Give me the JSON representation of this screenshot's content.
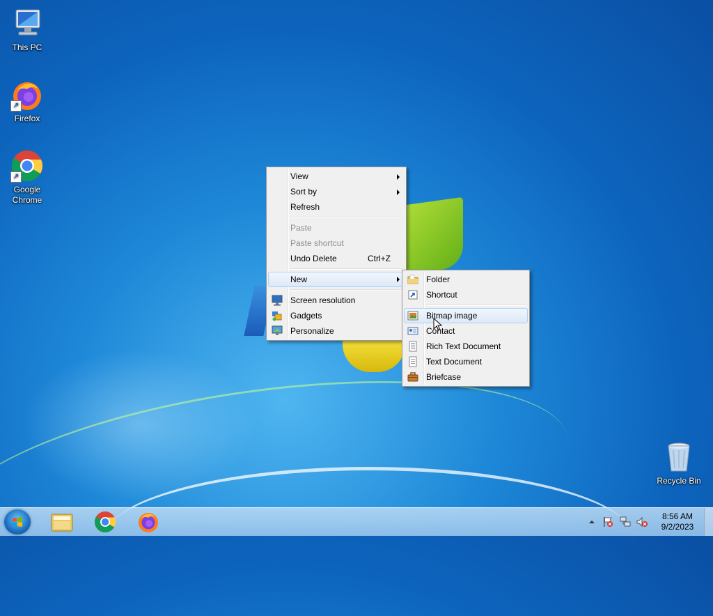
{
  "desktop": {
    "icons": [
      {
        "label": "This PC"
      },
      {
        "label": "Firefox"
      },
      {
        "label": "Google Chrome"
      },
      {
        "label": "Recycle Bin"
      }
    ]
  },
  "context_menu": {
    "view": "View",
    "sort_by": "Sort by",
    "refresh": "Refresh",
    "paste": "Paste",
    "paste_shortcut": "Paste shortcut",
    "undo_delete": "Undo Delete",
    "undo_shortcut": "Ctrl+Z",
    "new": "New",
    "screen_resolution": "Screen resolution",
    "gadgets": "Gadgets",
    "personalize": "Personalize"
  },
  "new_submenu": {
    "folder": "Folder",
    "shortcut": "Shortcut",
    "bitmap_image": "Bitmap image",
    "contact": "Contact",
    "rich_text_document": "Rich Text Document",
    "text_document": "Text Document",
    "briefcase": "Briefcase"
  },
  "taskbar": {
    "pinned": [
      {
        "icon": "file-explorer-icon"
      },
      {
        "icon": "chrome-icon"
      },
      {
        "icon": "firefox-icon"
      }
    ],
    "tray_icons": [
      "show-hidden-icons-arrow",
      "action-center-flag-icon",
      "network-icon",
      "volume-muted-icon"
    ],
    "clock": {
      "time": "8:56 AM",
      "date": "9/2/2023"
    }
  },
  "colors": {
    "menu_highlight": "#dce9f7",
    "desktop_blue": "#1e88d8"
  }
}
